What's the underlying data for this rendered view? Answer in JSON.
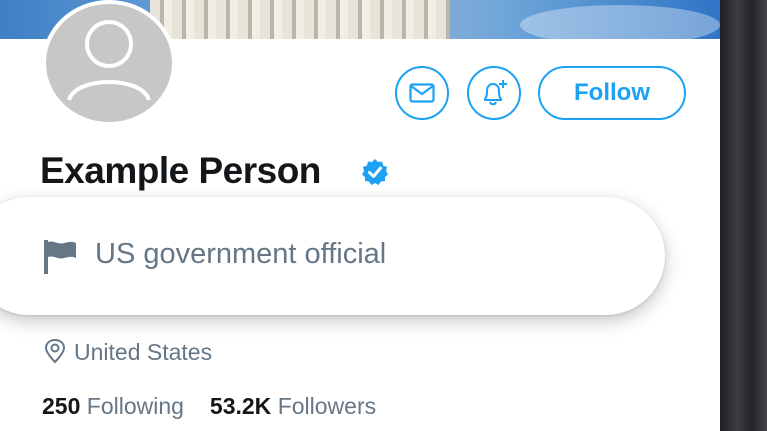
{
  "profile": {
    "name": "Example Person",
    "verified_icon": "verified-badge-icon",
    "label": "US government official",
    "location": "United States",
    "following_count": "250",
    "following_label": "Following",
    "followers_count": "53.2K",
    "followers_label": "Followers"
  },
  "actions": {
    "message_icon": "envelope-icon",
    "notification_icon": "bell-plus-icon",
    "follow_label": "Follow"
  },
  "colors": {
    "accent": "#1da1f2",
    "text_primary": "#14171a",
    "text_secondary": "#657786",
    "avatar_bg": "#c7c7c7"
  }
}
